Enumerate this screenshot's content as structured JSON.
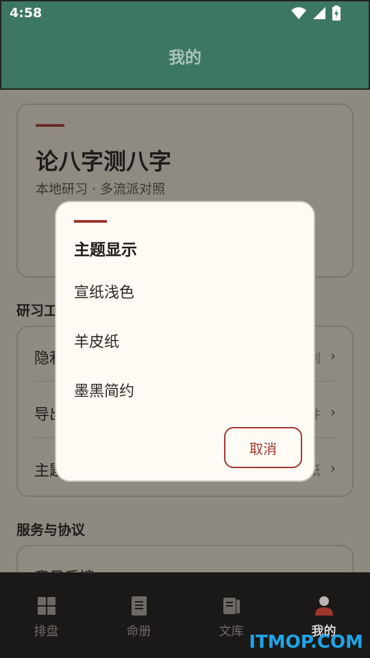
{
  "status": {
    "time": "4:58"
  },
  "header": {
    "title": "我的"
  },
  "hero": {
    "title": "论八字测八字",
    "subtitle": "本地研习 · 多流派对照"
  },
  "tools_section": {
    "label": "研习工",
    "rows": [
      {
        "label": "隐利",
        "value": "别"
      },
      {
        "label": "导出",
        "value": "件"
      },
      {
        "label": "主题",
        "value": "纸"
      }
    ]
  },
  "service_section": {
    "label": "服务与协议",
    "first_item": "意见反馈"
  },
  "dialog": {
    "title": "主题显示",
    "options": [
      "宣纸浅色",
      "羊皮纸",
      "墨黑简约"
    ],
    "cancel_label": "取消"
  },
  "nav": {
    "items": [
      {
        "label": "排盘",
        "icon": "grid-icon"
      },
      {
        "label": "命册",
        "icon": "book-icon"
      },
      {
        "label": "文库",
        "icon": "library-icon"
      },
      {
        "label": "我的",
        "icon": "person-icon"
      }
    ],
    "active_index": 3
  },
  "watermark": "ITMOP.COM",
  "colors": {
    "header": "#3c7763",
    "accent": "#a0372e",
    "nav_bg": "#1b1917"
  }
}
